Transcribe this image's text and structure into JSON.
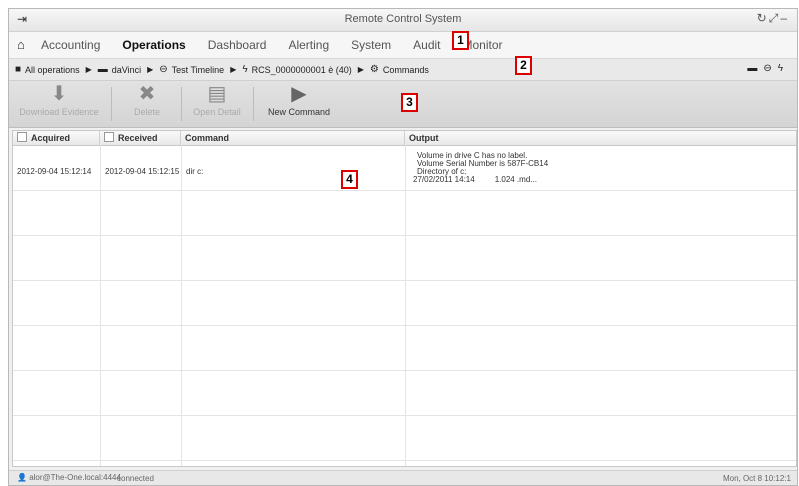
{
  "window": {
    "title": "Remote Control System"
  },
  "menu": {
    "items": [
      {
        "label": "Accounting",
        "active": false
      },
      {
        "label": "Operations",
        "active": true
      },
      {
        "label": "Dashboard",
        "active": false
      },
      {
        "label": "Alerting",
        "active": false
      },
      {
        "label": "System",
        "active": false
      },
      {
        "label": "Audit",
        "active": false
      },
      {
        "label": "Monitor",
        "active": false
      }
    ]
  },
  "breadcrumb": {
    "items": [
      {
        "label": "All operations",
        "icon": "operations-icon"
      },
      {
        "label": "daVinci",
        "icon": "folder-icon"
      },
      {
        "label": "Test Timeline",
        "icon": "target-icon"
      },
      {
        "label": "RCS_0000000001 è (40)",
        "icon": "agent-icon"
      },
      {
        "label": "Commands",
        "icon": "gear-icon"
      }
    ]
  },
  "toolbar": {
    "download": "Download Evidence",
    "delete": "Delete",
    "open_detail": "Open Detail",
    "new_command": "New Command"
  },
  "grid": {
    "headers": [
      "Acquired",
      "Received",
      "Command",
      "Output"
    ],
    "rows": [
      {
        "acquired": "2012-09-04 15:12:14",
        "received": "2012-09-04 15:12:15",
        "command": "dir c:",
        "output": [
          "Volume in drive C has no label.",
          "Volume Serial Number is 587F-CB14",
          "Directory of c:",
          "27/02/2011 14:14         1.024 .md..."
        ]
      }
    ]
  },
  "callouts": [
    "1",
    "2",
    "3",
    "4"
  ],
  "status": {
    "user": "alor@The-One.local:4444",
    "connection": "connected",
    "clock": "Mon, Oct 8  10:12:1"
  },
  "colors": {
    "callout_border": "#dd0000",
    "toolbar_bg": "#d9d9d9"
  }
}
